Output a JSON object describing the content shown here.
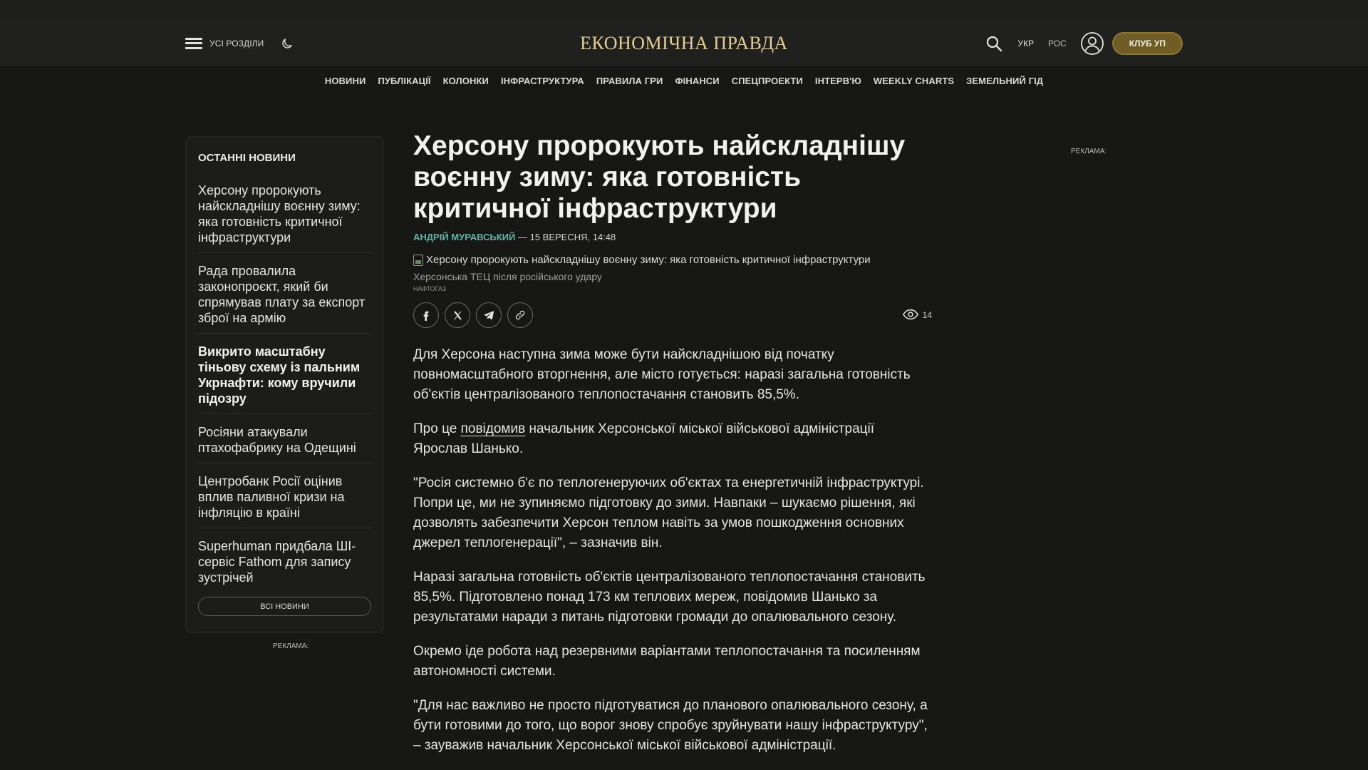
{
  "header": {
    "all_sections": "УСІ РОЗДІЛИ",
    "logo": "ЕКОНОМІЧНА ПРАВДА",
    "lang_ukr": "УКР",
    "lang_ros": "РОС",
    "club_button": "КЛУБ УП"
  },
  "nav": {
    "items": [
      "НОВИНИ",
      "ПУБЛІКАЦІЇ",
      "КОЛОНКИ",
      "ІНФРАСТРУКТУРА",
      "ПРАВИЛА ГРИ",
      "ФІНАНСИ",
      "СПЕЦПРОЕКТИ",
      "ІНТЕРВ'Ю",
      "WEEKLY CHARTS",
      "ЗЕМЕЛЬНИЙ ГІД"
    ]
  },
  "sidebar": {
    "title": "ОСТАННІ НОВИНИ",
    "items": [
      "Херсону пророкують найскладнішу воєнну зиму: яка готовність критичної інфраструктури",
      "Рада провалила законопроєкт, який би спрямував плату за експорт зброї на армію",
      "Викрито масштабну тіньову схему із пальним Укрнафти: кому вручили підозру",
      "Росіяни атакували птахофабрику на Одещині",
      "Центробанк Росії оцінив вплив паливної кризи на інфляцію в країні",
      "Superhuman придбала ШІ-сервіс Fathom для запису зустрічей"
    ],
    "all_news": "ВСІ НОВИНИ"
  },
  "ads": {
    "left_label": "РЕКЛАМА:",
    "right_label": "РЕКЛАМА:"
  },
  "article": {
    "title": "Херсону пророкують найскладнішу воєнну зиму: яка готовність критичної інфраструктури",
    "author": "АНДРІЙ МУРАВСЬКИЙ",
    "date": " — 15 ВЕРЕСНЯ, 14:48",
    "image_alt": "Херсону пророкують найскладнішу воєнну зиму: яка готовність критичної інфраструктури",
    "caption": "Херсонська ТЕЦ після російського удару",
    "credit": "НАФТОГАЗ",
    "views": "14",
    "p1": "Для Херсона наступна зима може бути найскладнішою від початку повномасштабного вторгнення, але місто готується: наразі загальна готовність об'єктів централізованого теплопостачання становить 85,5%.",
    "p2_before": "Про це ",
    "p2_link": "повідомив",
    "p2_after": " начальник Херсонської міської військової адміністрації Ярослав Шанько.",
    "p3": "\"Росія системно б'є по теплогенеруючих об'єктах та енергетичній інфраструктурі. Попри це, ми не зупиняємо підготовку до зими. Навпаки – шукаємо рішення, які дозволять забезпечити Херсон теплом навіть за умов пошкодження основних джерел теплогенерації\", – зазначив він.",
    "p4": "Наразі загальна готовність об'єктів централізованого теплопостачання становить 85,5%. Підготовлено понад 173 км теплових мереж, повідомив Шанько за результатами наради з питань підготовки громади до опалювального сезону.",
    "p5": "Окремо іде робота над резервними варіантами теплопостачання та посиленням автономності системи.",
    "p6": "\"Для нас важливо не просто підготуватися до планового опалювального сезону, а бути готовими до того, що ворог знову спробує зруйнувати нашу інфраструктуру\", – зауважив начальник Херсонської міської військової адміністрації."
  },
  "colors": {
    "background": "#171816",
    "header": "#20211f",
    "logo": "#e4ce92",
    "author": "#5fb4a5",
    "club_button": "#6f5d25"
  },
  "icons": [
    "hamburger-icon",
    "moon-icon",
    "search-icon",
    "user-icon",
    "facebook-icon",
    "x-icon",
    "telegram-icon",
    "link-icon",
    "eye-icon"
  ]
}
